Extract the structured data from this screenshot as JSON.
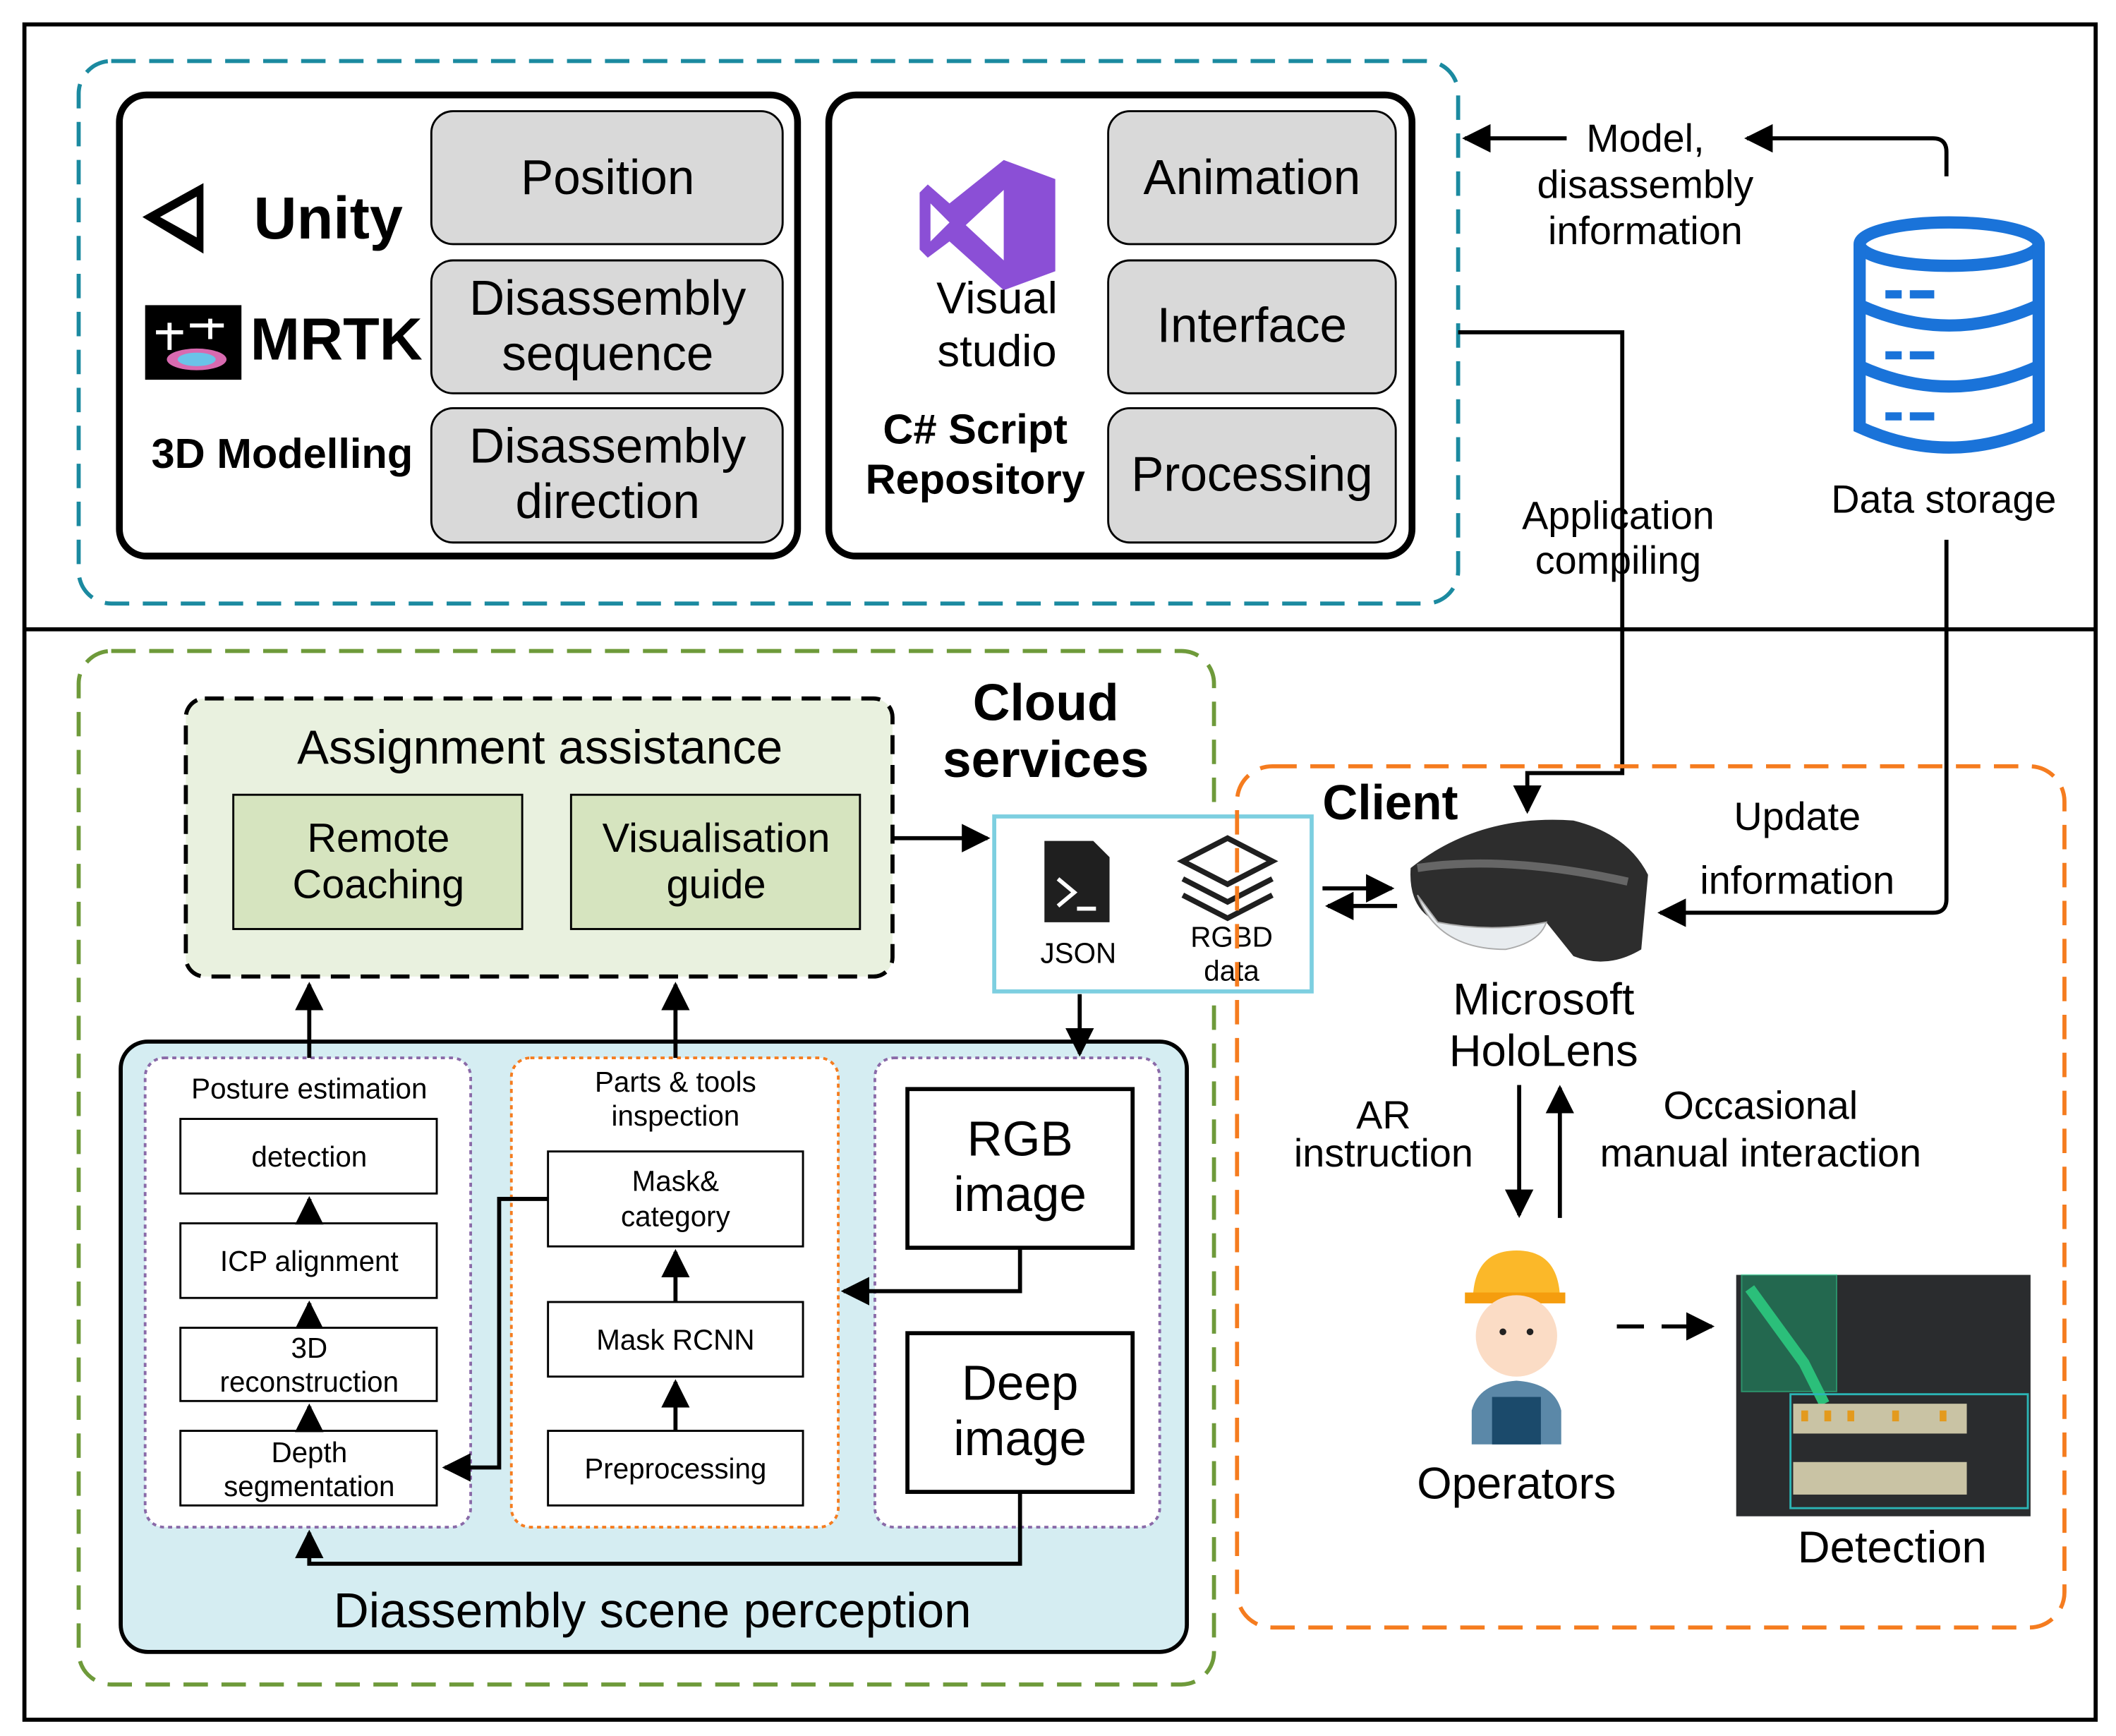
{
  "top": {
    "modelling": {
      "unity_label": "Unity",
      "mrtk_label": "MRTK",
      "caption": "3D Modelling",
      "items": [
        {
          "l1": "Position",
          "l2": ""
        },
        {
          "l1": "Disassembly",
          "l2": "sequence"
        },
        {
          "l1": "Disassembly",
          "l2": "direction"
        }
      ]
    },
    "scripts": {
      "vs_l1": "Visual",
      "vs_l2": "studio",
      "caption_l1": "C# Script",
      "caption_l2": "Repository",
      "items": [
        "Animation",
        "Interface",
        "Processing"
      ]
    },
    "model_info": {
      "l1": "Model,",
      "l2": "disassembly",
      "l3": "information"
    },
    "data_storage": "Data storage",
    "app_compiling": {
      "l1": "Application",
      "l2": "compiling"
    }
  },
  "cloud": {
    "title_l1": "Cloud",
    "title_l2": "services",
    "assignment": {
      "title": "Assignment assistance",
      "items": [
        {
          "l1": "Remote",
          "l2": "Coaching"
        },
        {
          "l1": "Visualisation",
          "l2": "guide"
        }
      ]
    },
    "data_box": {
      "json": "JSON",
      "rgbd_l1": "RGBD",
      "rgbd_l2": "data"
    },
    "perception": {
      "title": "Diassembly scene perception",
      "posture": {
        "title": "Posture estimation",
        "steps": [
          {
            "l1": "detection",
            "l2": ""
          },
          {
            "l1": "ICP alignment",
            "l2": ""
          },
          {
            "l1": "3D",
            "l2": "reconstruction"
          },
          {
            "l1": "Depth",
            "l2": "segmentation"
          }
        ]
      },
      "parts": {
        "title_l1": "Parts & tools",
        "title_l2": "inspection",
        "steps": [
          {
            "l1": "Mask&",
            "l2": "category"
          },
          {
            "l1": "Mask RCNN",
            "l2": ""
          },
          {
            "l1": "Preprocessing",
            "l2": ""
          }
        ]
      },
      "inputs": [
        {
          "l1": "RGB",
          "l2": "image"
        },
        {
          "l1": "Deep",
          "l2": "image"
        }
      ]
    }
  },
  "client": {
    "title": "Client",
    "device_l1": "Microsoft",
    "device_l2": "HoloLens",
    "update_l1": "Update",
    "update_l2": "information",
    "ar_l1": "AR",
    "ar_l2": "instruction",
    "occ_l1": "Occasional",
    "occ_l2": "manual interaction",
    "operators": "Operators",
    "detection": "Detection"
  },
  "colors": {
    "teal_dash": "#1b8aa0",
    "green_dash": "#6e9a3a",
    "orange_dash": "#f57c1f",
    "purple_dot": "#8a6aa8",
    "perception_fill": "#d5edf2",
    "assignment_fill": "#e9f1df",
    "subbox_fill": "#d6e4bf",
    "storage_blue": "#1a73d9",
    "vs_purple": "#8b4fd6"
  },
  "icons": [
    "unity-logo",
    "mrtk-logo",
    "visual-studio-logo",
    "database-icon",
    "json-file-icon",
    "layers-icon",
    "hololens-image",
    "operator-icon",
    "detection-image"
  ]
}
